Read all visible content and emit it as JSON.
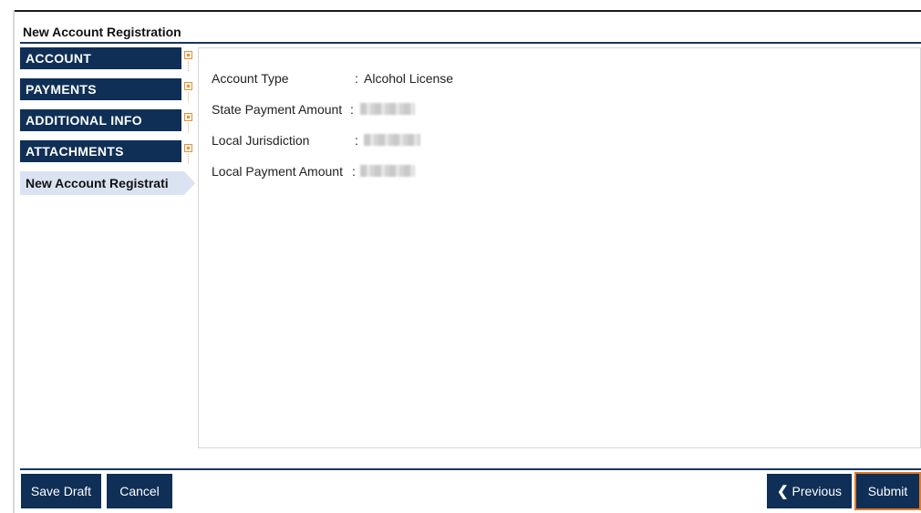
{
  "page": {
    "title": "New Account Registration"
  },
  "steps": [
    {
      "label": "ACCOUNT"
    },
    {
      "label": "PAYMENTS"
    },
    {
      "label": "ADDITIONAL INFO"
    },
    {
      "label": "ATTACHMENTS"
    }
  ],
  "current_step": {
    "label": "New Account Registrati"
  },
  "summary": {
    "separator": ":",
    "fields": [
      {
        "label": "Account Type",
        "value": "Alcohol License"
      },
      {
        "label": "State Payment Amount",
        "value": null
      },
      {
        "label": "Local Jurisdiction",
        "value": null
      },
      {
        "label": "Local Payment Amount",
        "value": null
      }
    ]
  },
  "footer": {
    "save_draft": "Save Draft",
    "cancel": "Cancel",
    "previous": "Previous",
    "submit": "Submit"
  },
  "colors": {
    "nav_dark": "#0f2f56",
    "current_step_bg": "#dbe3f2",
    "marker_orange": "#e8913a",
    "submit_outline": "#e07b2a"
  },
  "icons": {
    "previous": "chevron-left-icon",
    "step_marker": "step-marker-icon"
  }
}
